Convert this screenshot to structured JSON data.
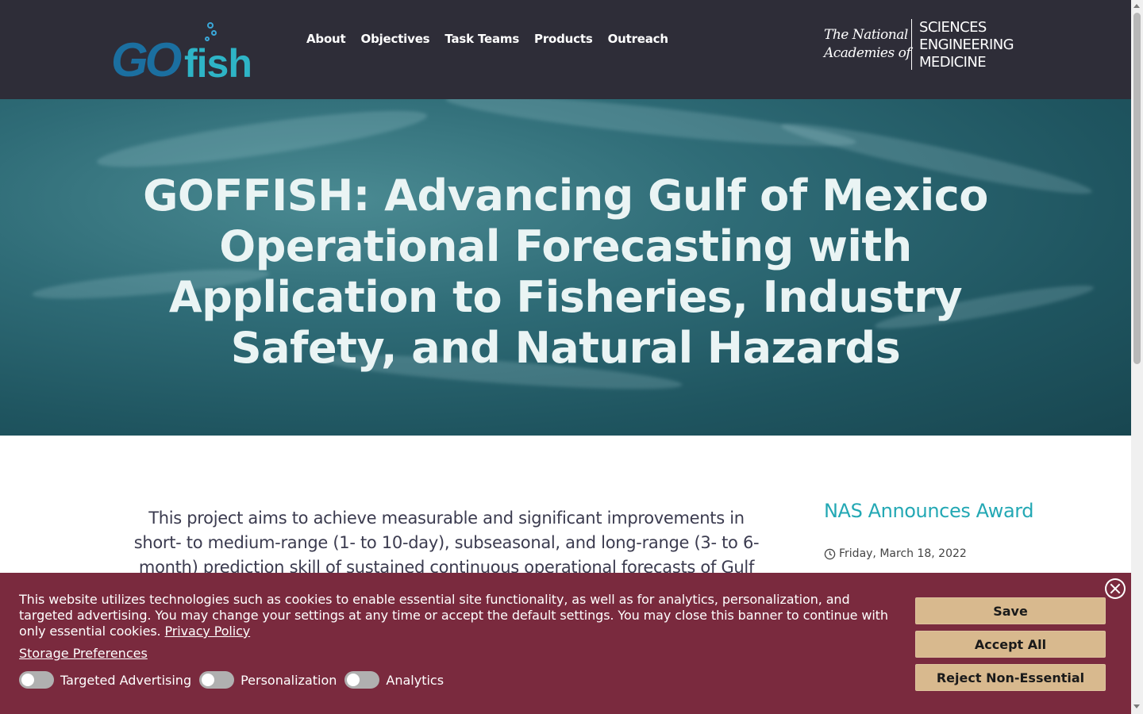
{
  "logo": {
    "go_text": "GO",
    "fish_text": "fish"
  },
  "nav": {
    "items": [
      "About",
      "Objectives",
      "Task Teams",
      "Products",
      "Outreach"
    ]
  },
  "partner": {
    "left_line1": "The National",
    "left_line2": "Academies of",
    "right_line1": "SCIENCES",
    "right_line2": "ENGINEERING",
    "right_line3": "MEDICINE"
  },
  "hero": {
    "title": "GOFFISH: Advancing Gulf of Mexico Operational Forecasting with Application to Fisheries, Industry Safety, and Natural Hazards"
  },
  "main": {
    "intro": "This project aims to achieve measurable and significant improvements in short- to medium-range (1- to 10-day), subseasonal, and long-range (3- to 6-month) prediction skill of sustained continuous operational forecasts of Gulf"
  },
  "sidebar": {
    "news_title": "NAS Announces Award",
    "news_date": "Friday, March 18, 2022"
  },
  "cookie_banner": {
    "text": "This website utilizes technologies such as cookies to enable essential site functionality, as well as for analytics, personalization, and targeted advertising. You may change your settings at any time or accept the default settings. You may close this banner to continue with only essential cookies.",
    "privacy_link": "Privacy Policy",
    "storage_link": "Storage Preferences",
    "toggles": [
      "Targeted Advertising",
      "Personalization",
      "Analytics"
    ],
    "save_label": "Save",
    "accept_label": "Accept All",
    "reject_label": "Reject Non-Essential"
  },
  "colors": {
    "header_bg": "#2e2d38",
    "banner_bg": "#7a2a3e",
    "button_bg": "#d8b98e",
    "accent_teal": "#23a8b4"
  }
}
